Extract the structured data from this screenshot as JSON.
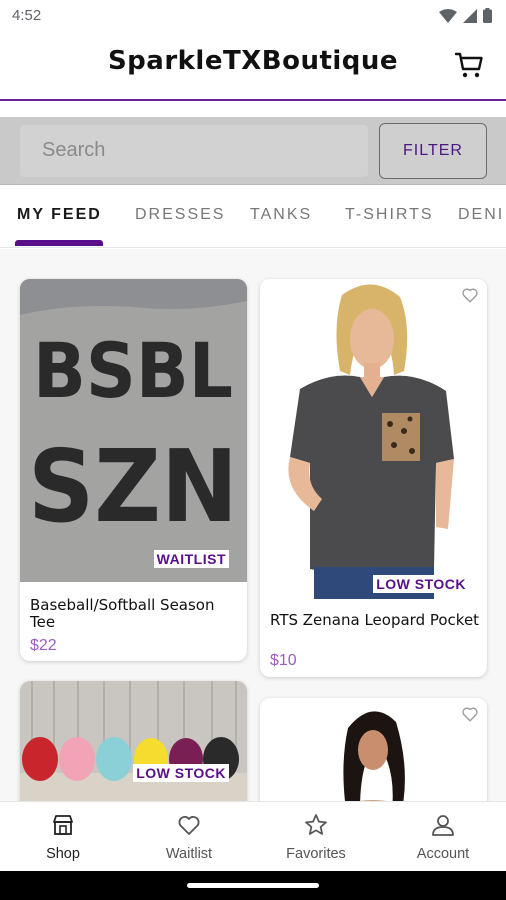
{
  "status_bar": {
    "time": "4:52"
  },
  "app_bar": {
    "title": "SparkleTXBoutique",
    "cart_icon": "cart-icon"
  },
  "search": {
    "placeholder": "Search",
    "filter_label": "FILTER"
  },
  "tabs": [
    {
      "label": "MY FEED",
      "active": true
    },
    {
      "label": "DRESSES",
      "active": false
    },
    {
      "label": "TANKS",
      "active": false
    },
    {
      "label": "T-SHIRTS",
      "active": false
    },
    {
      "label": "DENI",
      "active": false
    }
  ],
  "products": [
    {
      "title": "Baseball/Softball Season Tee",
      "price": "$22",
      "badge": "WAITLIST",
      "print_text": "BSBL SZN"
    },
    {
      "title": "RTS Zenana Leopard Pocket",
      "price": "$10",
      "badge": "LOW STOCK"
    },
    {
      "title": "",
      "price": "",
      "badge": "LOW STOCK"
    },
    {
      "title": "",
      "price": "",
      "badge": ""
    }
  ],
  "bottom_nav": [
    {
      "label": "Shop",
      "icon": "shop-icon",
      "active": true
    },
    {
      "label": "Waitlist",
      "icon": "heart-icon",
      "active": false
    },
    {
      "label": "Favorites",
      "icon": "star-icon",
      "active": false
    },
    {
      "label": "Account",
      "icon": "person-icon",
      "active": false
    }
  ],
  "colors": {
    "accent": "#5a0f8a",
    "price": "#9b5fc0",
    "search_band": "#c9c9c9"
  }
}
